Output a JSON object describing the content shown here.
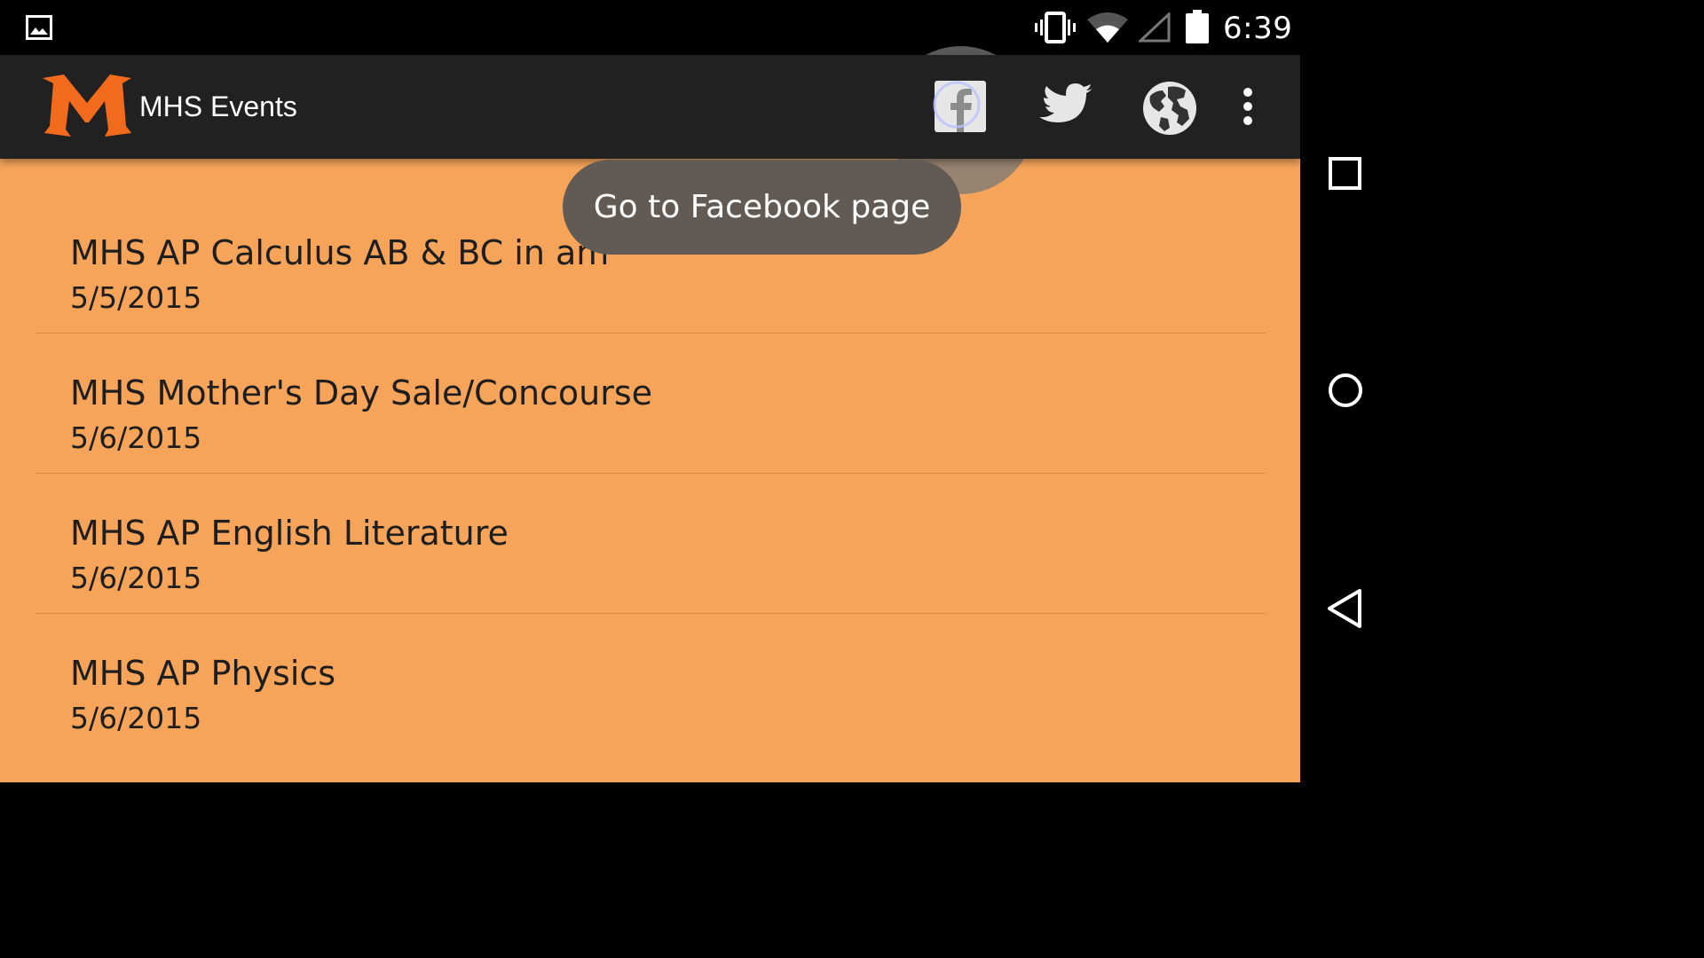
{
  "status_bar": {
    "time": "6:39",
    "icons": [
      "image-notification-icon",
      "vibrate-icon",
      "wifi-icon",
      "signal-icon",
      "battery-icon"
    ]
  },
  "action_bar": {
    "title": "MHS Events",
    "logo_letter": "M",
    "actions": [
      "facebook-icon",
      "twitter-icon",
      "globe-icon",
      "overflow-menu-icon"
    ]
  },
  "toast": {
    "text": "Go to Facebook page"
  },
  "events": [
    {
      "title": "MHS AP Calculus AB & BC in am",
      "date": "5/5/2015"
    },
    {
      "title": "MHS Mother's Day Sale/Concourse",
      "date": "5/6/2015"
    },
    {
      "title": "MHS AP English Literature",
      "date": "5/6/2015"
    },
    {
      "title": "MHS AP Physics",
      "date": "5/6/2015"
    }
  ],
  "nav_bar": {
    "buttons": [
      "recents-icon",
      "home-icon",
      "back-icon"
    ]
  },
  "colors": {
    "content_bg": "#f6a45a",
    "action_bar_bg": "#212121",
    "logo_orange": "#f26a1b",
    "toast_bg": "#625b55"
  }
}
